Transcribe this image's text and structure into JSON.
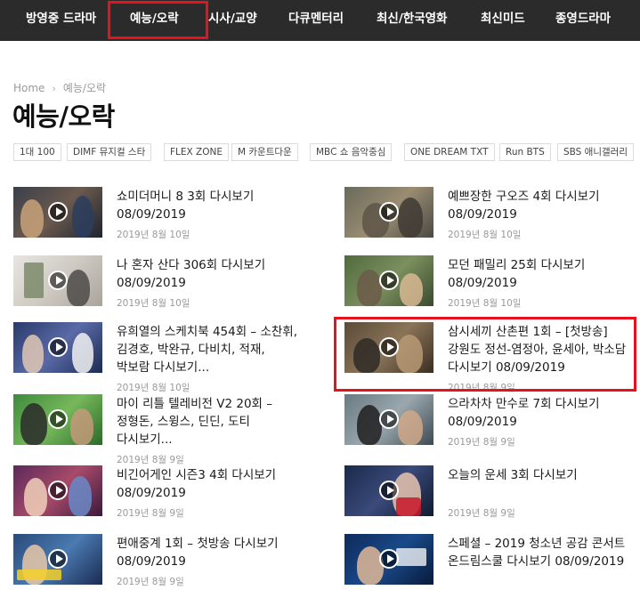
{
  "nav": {
    "items": [
      "방영중 드라마",
      "예능/오락",
      "시사/교양",
      "다큐멘터리",
      "최신/한국영화",
      "최신미드",
      "종영드라마"
    ],
    "active_index": 1
  },
  "breadcrumb": {
    "home": "Home",
    "separator": "›",
    "current": "예능/오락"
  },
  "page_title": "예능/오락",
  "tags": [
    "1대 100",
    "DIMF 뮤지컬 스타",
    "FLEX ZONE",
    "M 카운트다운",
    "MBC 쇼 음악중심",
    "ONE DREAM TXT",
    "Run BTS",
    "SBS 애니갤러리"
  ],
  "posts": [
    {
      "title": "쇼미더머니 8 3회 다시보기 08/09/2019",
      "date": "2019년 8월 10일"
    },
    {
      "title": "예쁘장한 구오즈 4회 다시보기 08/09/2019",
      "date": "2019년 8월 10일"
    },
    {
      "title": "나 혼자 산다 306회 다시보기 08/09/2019",
      "date": "2019년 8월 10일"
    },
    {
      "title": "모던 패밀리 25회 다시보기 08/09/2019",
      "date": "2019년 8월 10일"
    },
    {
      "title": "유희열의 스케치북 454회 – 소찬휘, 김경호, 박완규, 다비치, 적재, 박보람 다시보기...",
      "date": "2019년 8월 10일"
    },
    {
      "title": "삼시세끼 산촌편 1회 – [첫방송]강원도 정선-염정아, 윤세아, 박소담 다시보기 08/09/2019",
      "date": "2019년 8월 9일"
    },
    {
      "title": "마이 리틀 텔레비전 V2 20회 – 정형돈, 스윙스, 딘딘, 도티 다시보기...",
      "date": "2019년 8월 9일"
    },
    {
      "title": "으라차차 만수로 7회 다시보기 08/09/2019",
      "date": "2019년 8월 9일"
    },
    {
      "title": "비긴어게인 시즌3 4회 다시보기 08/09/2019",
      "date": "2019년 8월 9일"
    },
    {
      "title": "오늘의 운세 3회 다시보기",
      "date": "2019년 8월 9일"
    },
    {
      "title": "편애중계 1회 – 첫방송 다시보기 08/09/2019",
      "date": "2019년 8월 9일"
    },
    {
      "title": "스페셜 – 2019 청소년 공감 콘서트 온드림스쿨 다시보기 08/09/2019",
      "date": ""
    }
  ],
  "colors": {
    "nav_bg": "#2b2b2b",
    "highlight_red": "#e8121d",
    "meta_gray": "#999999"
  }
}
